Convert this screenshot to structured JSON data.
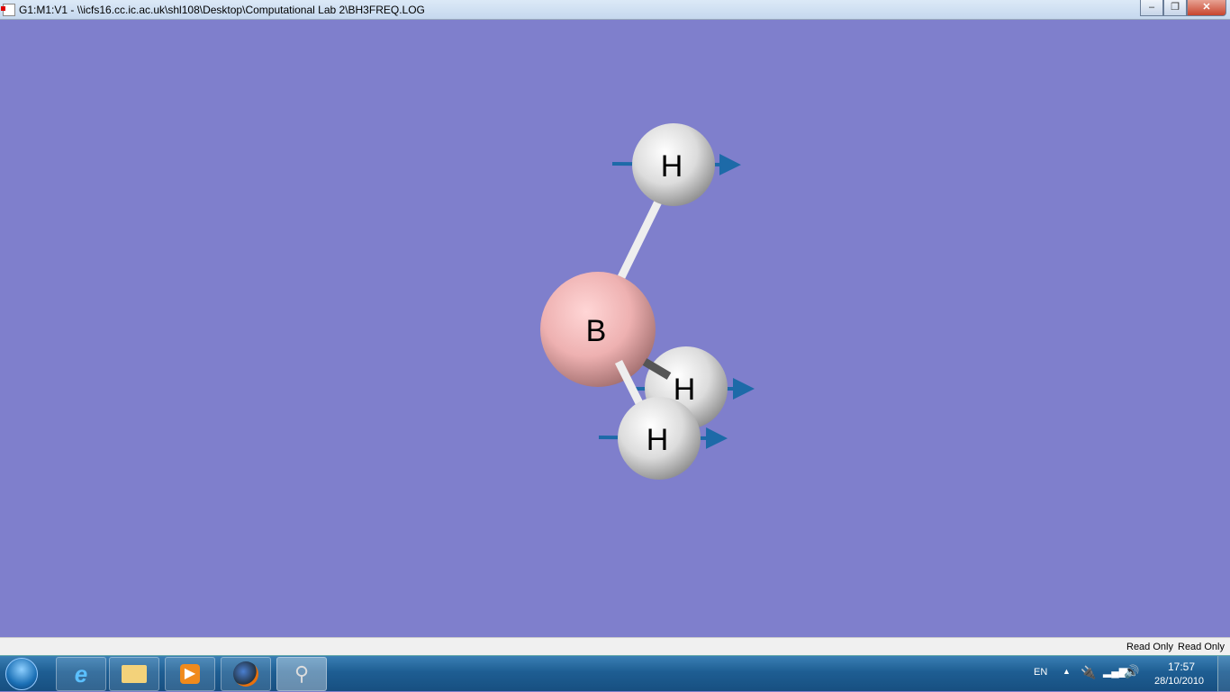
{
  "window": {
    "title": "G1:M1:V1 - \\\\icfs16.cc.ic.ac.uk\\shl108\\Desktop\\Computational Lab 2\\BH3FREQ.LOG",
    "minimize": "–",
    "maximize": "❐",
    "close": "✕"
  },
  "molecule": {
    "atoms": [
      {
        "label": "H"
      },
      {
        "label": "B"
      },
      {
        "label": "H"
      },
      {
        "label": "H"
      }
    ],
    "background": "#7f7fcc"
  },
  "statusbar": {
    "field1": "Read Only",
    "field2": "Read Only"
  },
  "taskbar": {
    "apps": [
      "internet-explorer",
      "windows-explorer",
      "media-player",
      "firefox",
      "gaussview"
    ]
  },
  "tray": {
    "language": "EN",
    "time": "17:57",
    "date": "28/10/2010"
  }
}
